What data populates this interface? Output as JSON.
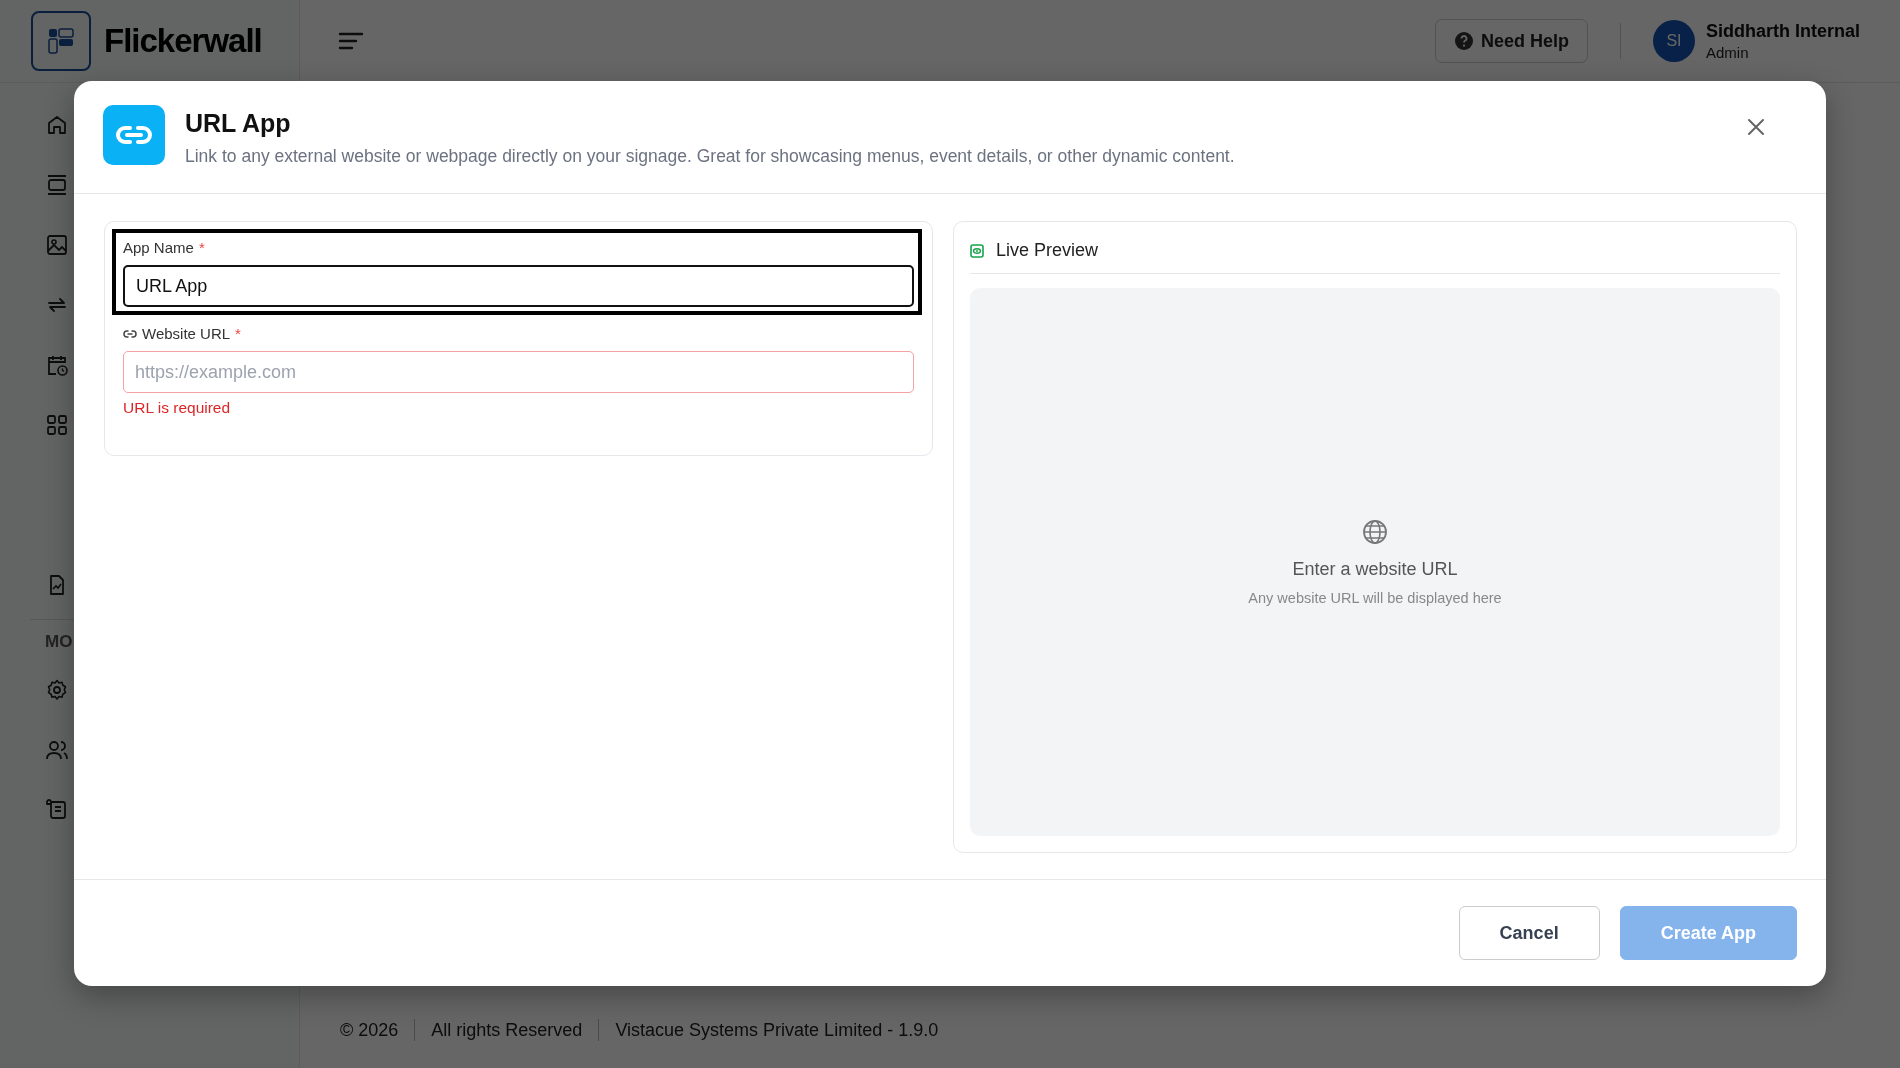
{
  "header": {
    "brand": "Flickerwall",
    "help_button": "Need Help",
    "user": {
      "initials": "SI",
      "name": "Siddharth Internal",
      "role": "Admin"
    }
  },
  "sidebar": {
    "section_label": "MO"
  },
  "footer": [
    "© 2026",
    "All rights Reserved",
    "Vistacue Systems Private Limited - 1.9.0"
  ],
  "dialog": {
    "title": "URL App",
    "description": "Link to any external website or webpage directly on your signage. Great for showcasing menus, event details, or other dynamic content.",
    "fields": [
      {
        "kind": "text",
        "label": "App Name",
        "required_mark": "*",
        "value": "URL App",
        "focused": true
      },
      {
        "kind": "url",
        "label": "Website URL",
        "required_mark": "*",
        "placeholder": "https://example.com",
        "error": "URL is required",
        "focused": false
      }
    ],
    "preview": {
      "title": "Live Preview",
      "empty_title": "Enter a website URL",
      "empty_hint": "Any website URL will be displayed here"
    },
    "buttons": [
      {
        "kind": "secondary",
        "label": "Cancel",
        "disabled": false
      },
      {
        "kind": "primary",
        "label": "Create App",
        "disabled": true
      }
    ]
  }
}
